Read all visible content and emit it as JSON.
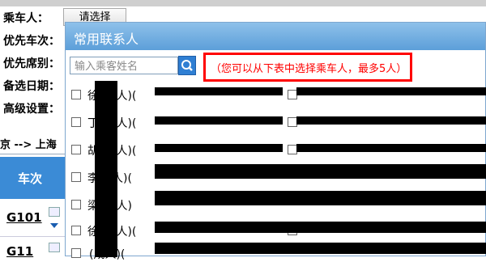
{
  "form": {
    "passenger_label": "乘车人：",
    "choose_button": "请选择",
    "priority_train_label": "优先车次：",
    "priority_seat_label": "优先席别：",
    "backup_date_label": "备选日期：",
    "advanced_label": "高级设置："
  },
  "route_text": "京 --> 上海",
  "train_table": {
    "header": "车次",
    "rows": [
      "G101",
      "G11"
    ]
  },
  "dialog": {
    "title": "常用联系人",
    "search_placeholder": "输入乘客姓名",
    "hint": "（您可以从下表中选择乘车人，最多5人）",
    "passengers": [
      {
        "name": "徐",
        "type": "(成人)(",
        "visible_id": ""
      },
      {
        "name": "丁",
        "type": "(成人)(",
        "visible_id": ""
      },
      {
        "name": "胡",
        "type": "(成人)(",
        "visible_id": ""
      },
      {
        "name": "李",
        "type": "成人)(",
        "visible_id": ""
      },
      {
        "name": "梁",
        "type": "(成人)",
        "visible_id": ""
      },
      {
        "name": "徐",
        "type": "(成人)(",
        "visible_id": ""
      },
      {
        "name": "",
        "type": "(成人)(",
        "visible_id": ""
      }
    ]
  },
  "colors": {
    "dialog_title_bg": "#5c9fd9",
    "hint_red": "#ff0000",
    "header_blue": "#3b8bd6"
  },
  "icons": {
    "search": "search-icon",
    "passenger_card": "id-card-icon"
  }
}
